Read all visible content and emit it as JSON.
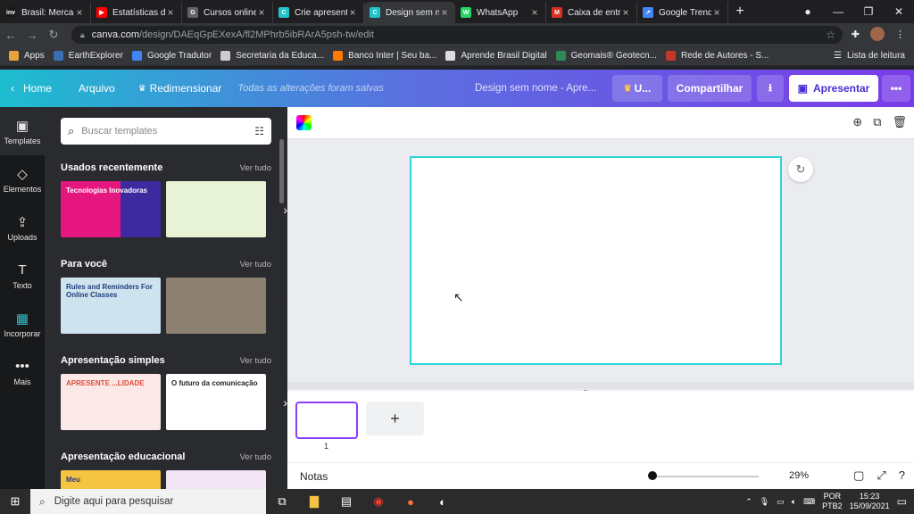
{
  "browser": {
    "tabs": [
      {
        "label": "Brasil: Mercad",
        "fav": "inv",
        "color": "#1a1a1a"
      },
      {
        "label": "Estatísticas do",
        "fav": "▶",
        "color": "#ff0000"
      },
      {
        "label": "Cursos online",
        "fav": "G",
        "color": "#5f6368"
      },
      {
        "label": "Crie apresent",
        "fav": "C",
        "color": "#20c4cb"
      },
      {
        "label": "Design sem n",
        "fav": "C",
        "color": "#20c4cb"
      },
      {
        "label": "WhatsApp",
        "fav": "W",
        "color": "#25d366"
      },
      {
        "label": "Caixa de entr",
        "fav": "M",
        "color": "#d93025"
      },
      {
        "label": "Google Trend",
        "fav": "↗",
        "color": "#4285f4"
      }
    ],
    "url_host": "canva.com",
    "url_path": "/design/DAEqGpEXexA/fl2MPhrb5ibRArA5psh-tw/edit",
    "bookmarks": [
      {
        "label": "Apps",
        "color": "#e8a33d"
      },
      {
        "label": "EarthExplorer",
        "color": "#3b6fb5"
      },
      {
        "label": "Google Tradutor",
        "color": "#4285f4"
      },
      {
        "label": "Secretaria da Educa...",
        "color": "#cccccc"
      },
      {
        "label": "Banco Inter | Seu ba...",
        "color": "#ff7a00"
      },
      {
        "label": "Aprende Brasil Digital",
        "color": "#dddddd"
      },
      {
        "label": "Geomais® Geotecn...",
        "color": "#2e8b57"
      },
      {
        "label": "Rede de Autores - S...",
        "color": "#c0392b"
      }
    ],
    "reading_list": "Lista de leitura"
  },
  "header": {
    "home": "Home",
    "file": "Arquivo",
    "resize": "Redimensionar",
    "saved": "Todas as alterações foram salvas",
    "design_name": "Design sem nome - Apre...",
    "upgrade": "U...",
    "share": "Compartilhar",
    "present": "Apresentar",
    "more": "•••"
  },
  "rail": [
    {
      "label": "Templates",
      "icon": "▣"
    },
    {
      "label": "Elementos",
      "icon": "◇"
    },
    {
      "label": "Uploads",
      "icon": "⇪"
    },
    {
      "label": "Texto",
      "icon": "T"
    },
    {
      "label": "Incorporar",
      "icon": "▦"
    },
    {
      "label": "Mais",
      "icon": "•••"
    }
  ],
  "panel": {
    "search_placeholder": "Buscar templates",
    "see_all": "Ver tudo",
    "sections": [
      {
        "title": "Usados recentemente",
        "t1_text": "Tecnologias Inovadoras",
        "t2_text": ""
      },
      {
        "title": "Para você",
        "t1_text": "Rules and Reminders For Online Classes",
        "t2_text": ""
      },
      {
        "title": "Apresentação simples",
        "t1_text": "APRESENTE ...LIDADE",
        "t2_text": "O futuro da comunicação"
      },
      {
        "title": "Apresentação educacional",
        "t1_text": "Meu",
        "t2_text": ""
      }
    ]
  },
  "editor": {
    "page_number": "1",
    "add_page": "+",
    "notes": "Notas",
    "zoom": "29%",
    "zoom_fraction": 0.29
  },
  "taskbar": {
    "search": "Digite aqui para pesquisar",
    "lang1": "POR",
    "lang2": "PTB2",
    "time": "15:23",
    "date": "15/09/2021"
  }
}
